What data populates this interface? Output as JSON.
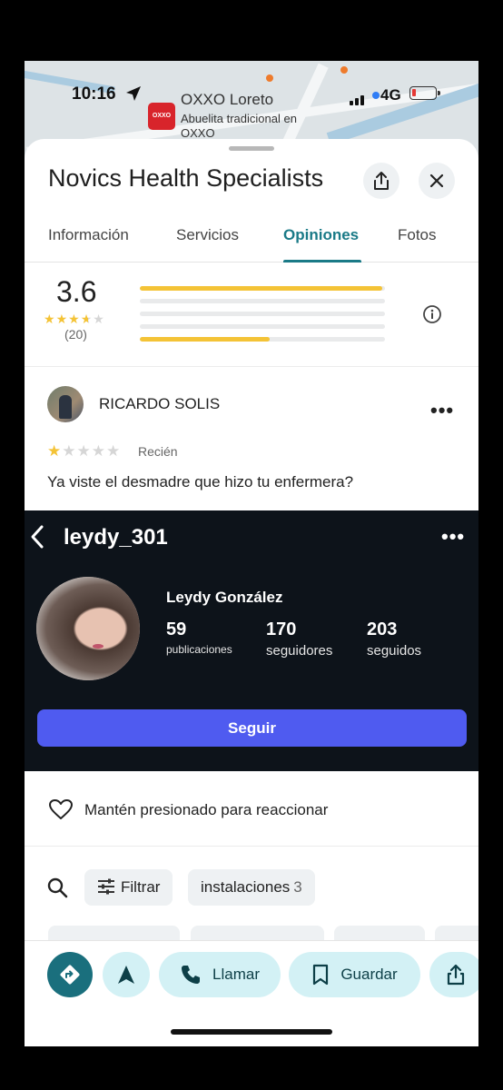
{
  "status_bar": {
    "time": "10:16",
    "network": "4G"
  },
  "map": {
    "place_name": "OXXO Loreto",
    "place_sub": "Abuelita tradicional en OXXO",
    "logo_text": "OXXO"
  },
  "header": {
    "title": "Novics Health Specialists"
  },
  "tabs": [
    {
      "label": "Información"
    },
    {
      "label": "Servicios"
    },
    {
      "label": "Opiniones"
    },
    {
      "label": "Fotos"
    }
  ],
  "rating": {
    "value": "3.6",
    "stars": 3.6,
    "count": "(20)",
    "distribution": [
      0.99,
      0,
      0,
      0,
      0.53
    ]
  },
  "review": {
    "author": "RICARDO SOLIS",
    "stars": 1,
    "time": "Recién",
    "text": "Ya viste el desmadre que hizo tu enfermera?"
  },
  "profile": {
    "handle": "leydy_301",
    "name": "Leydy González",
    "stats": [
      {
        "value": "59",
        "label": "publicaciones"
      },
      {
        "value": "170",
        "label": "seguidores"
      },
      {
        "value": "203",
        "label": "seguidos"
      }
    ],
    "follow_label": "Seguir"
  },
  "react_hint": "Mantén presionado para reaccionar",
  "filters": {
    "filter_label": "Filtrar",
    "topic_label": "instalaciones",
    "topic_count": "3"
  },
  "actions": {
    "call_label": "Llamar",
    "save_label": "Guardar"
  },
  "colors": {
    "accent": "#1a7a87",
    "star": "#f4c336",
    "follow": "#4f5bf0",
    "action_bg": "#d3f1f5"
  }
}
